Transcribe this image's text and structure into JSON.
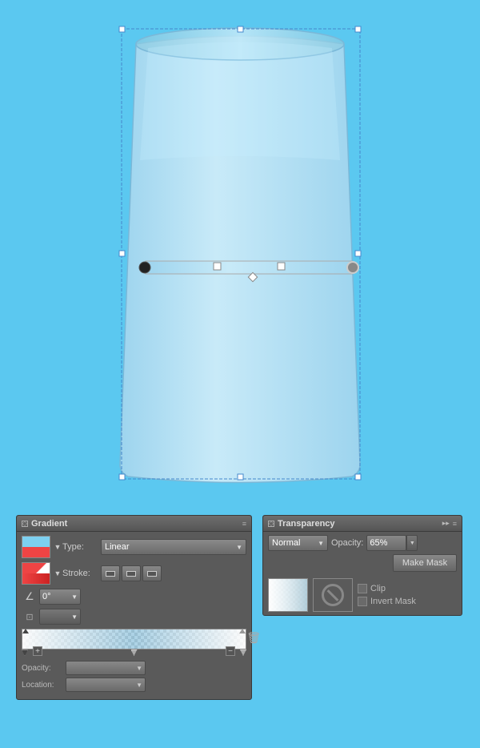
{
  "canvas": {
    "background_color": "#5bc8f0"
  },
  "cup": {
    "description": "A cup/tumbler shape with gradient fill",
    "fill_color": "#a8d8f0",
    "stroke_color": "#7ab8d8"
  },
  "gradient_bar": {
    "description": "Gradient tool bar overlaid on cup middle"
  },
  "gradient_panel": {
    "title": "Gradient",
    "type_label": "Type:",
    "type_value": "Linear",
    "stroke_label": "Stroke:",
    "angle_value": "0°",
    "opacity_label": "Opacity:",
    "location_label": "Location:",
    "menu_icon": "≡"
  },
  "transparency_panel": {
    "title": "Transparency",
    "blend_label": "Normal",
    "opacity_label": "Opacity:",
    "opacity_value": "65%",
    "make_mask_label": "Make Mask",
    "clip_label": "Clip",
    "invert_mask_label": "Invert Mask",
    "expand_icon": "▸▸",
    "menu_icon": "≡"
  }
}
